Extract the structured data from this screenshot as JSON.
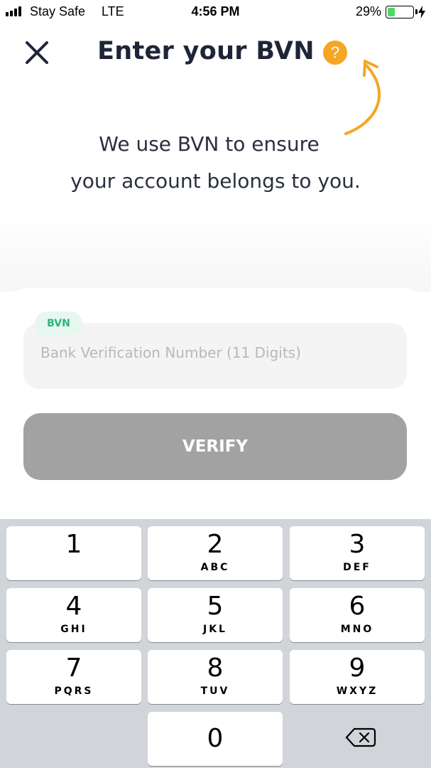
{
  "status_bar": {
    "carrier": "Stay Safe",
    "network": "LTE",
    "time": "4:56 PM",
    "battery_percent": "29%",
    "battery_level": 0.29,
    "battery_color": "#4cd964"
  },
  "header": {
    "title": "Enter your BVN",
    "close_icon": "close-icon",
    "help_label": "?",
    "help_color": "#f5a623"
  },
  "description": {
    "line1": "We use BVN to ensure",
    "line2": "your account belongs to you."
  },
  "form": {
    "field_label": "BVN",
    "field_value": "",
    "field_placeholder": "Bank Verification Number (11 Digits)",
    "verify_label": "VERIFY",
    "label_color": "#2db37c",
    "button_color": "#a2a2a2"
  },
  "keypad": {
    "keys": [
      {
        "digit": "1",
        "letters": ""
      },
      {
        "digit": "2",
        "letters": "ABC"
      },
      {
        "digit": "3",
        "letters": "DEF"
      },
      {
        "digit": "4",
        "letters": "GHI"
      },
      {
        "digit": "5",
        "letters": "JKL"
      },
      {
        "digit": "6",
        "letters": "MNO"
      },
      {
        "digit": "7",
        "letters": "PQRS"
      },
      {
        "digit": "8",
        "letters": "TUV"
      },
      {
        "digit": "9",
        "letters": "WXYZ"
      },
      {
        "digit": "0",
        "letters": ""
      }
    ],
    "delete_icon": "backspace-icon"
  }
}
